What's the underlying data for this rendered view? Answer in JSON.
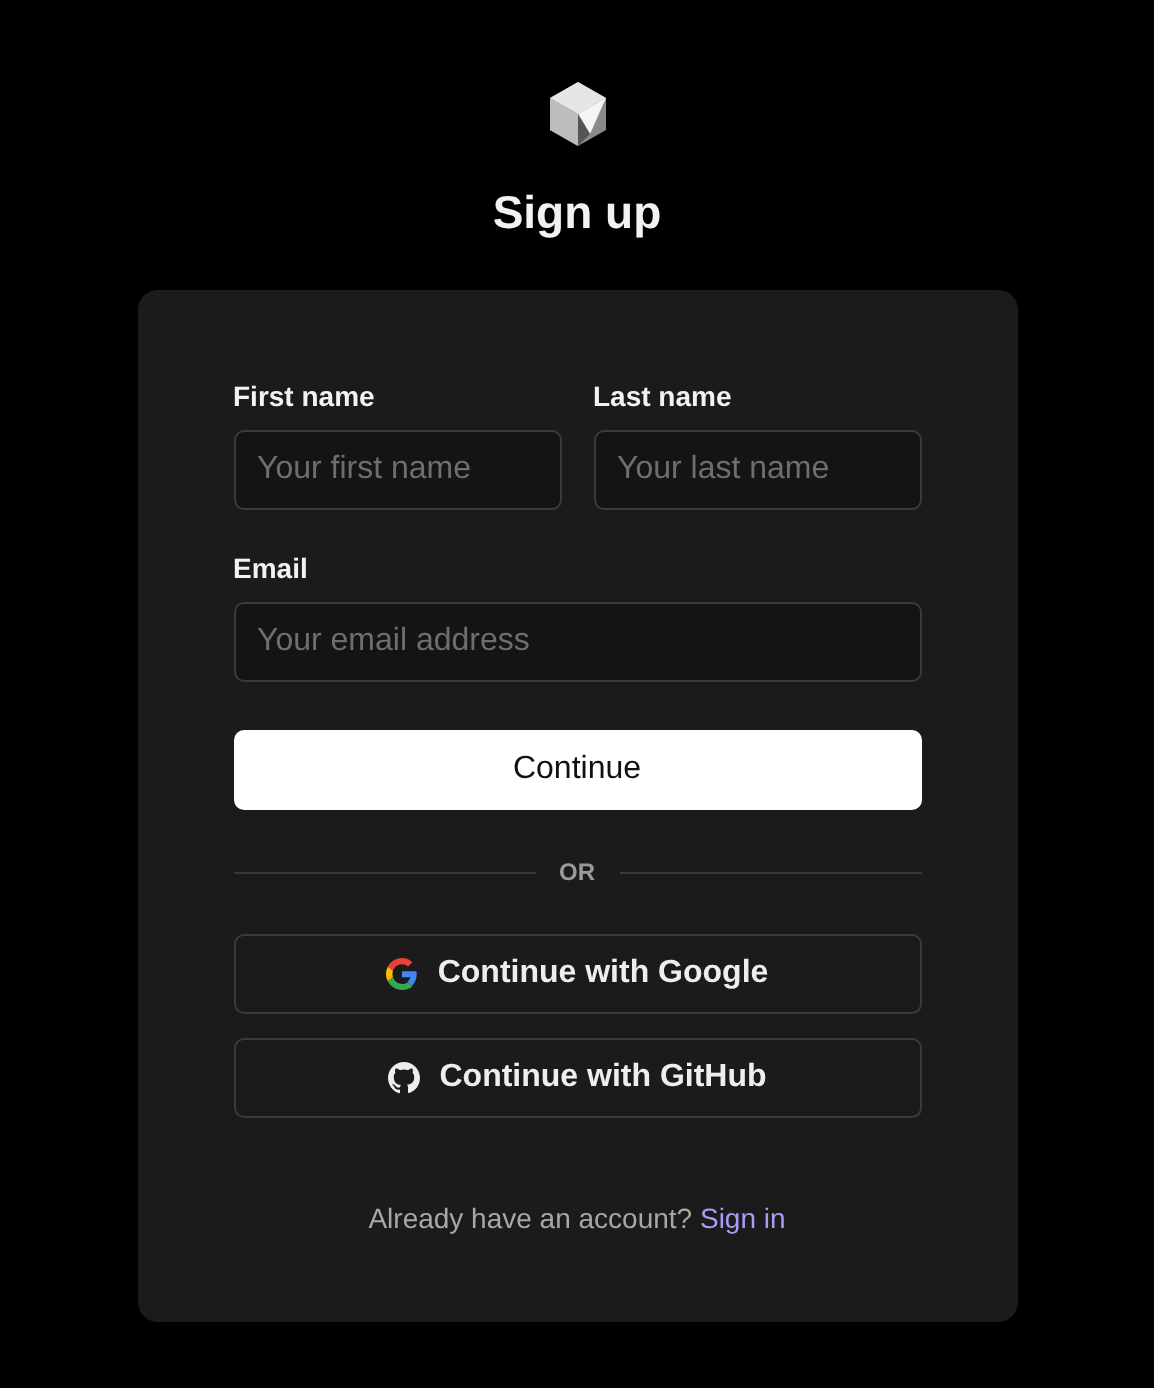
{
  "title": "Sign up",
  "name_fields": [
    {
      "label": "First name",
      "placeholder": "Your first name"
    },
    {
      "label": "Last name",
      "placeholder": "Your last name"
    }
  ],
  "email_field": {
    "label": "Email",
    "placeholder": "Your email address"
  },
  "continue_button": "Continue",
  "divider": "OR",
  "social_buttons": [
    {
      "kind": "google",
      "label": "Continue with Google"
    },
    {
      "kind": "github",
      "label": "Continue with GitHub"
    }
  ],
  "footer": {
    "text": "Already have an account?",
    "link": "Sign in"
  }
}
